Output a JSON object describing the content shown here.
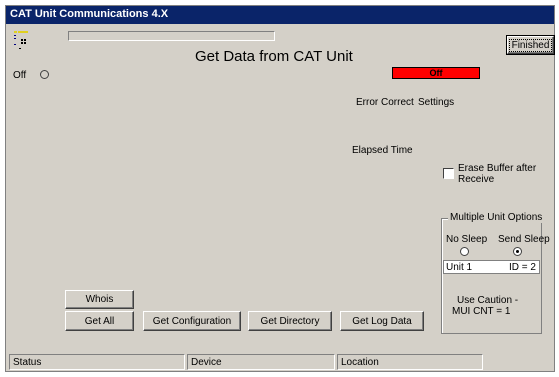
{
  "window": {
    "title": "CAT Unit Communications 4.X"
  },
  "header": {
    "heading": "Get Data from CAT Unit",
    "finished_label": "Finished"
  },
  "power": {
    "label": "Off"
  },
  "status_indicator": {
    "text": "Off",
    "color": "#ff0000"
  },
  "info": {
    "error_correct_label": "Error Correct",
    "settings_label": "Settings",
    "elapsed_time_label": "Elapsed Time"
  },
  "erase_buffer": {
    "label_line1": "Erase Buffer after",
    "label_line2": "Receive",
    "checked": false
  },
  "multi_unit": {
    "group_label": "Multiple Unit Options",
    "no_sleep_label": "No Sleep",
    "send_sleep_label": "Send Sleep",
    "selected": "Send Sleep",
    "unit_name": "Unit 1",
    "unit_id": "ID = 2",
    "caution_line1": "Use Caution  -",
    "caution_line2": "MUI CNT = 1"
  },
  "actions": {
    "whois": "Whois",
    "get_all": "Get All",
    "get_configuration": "Get Configuration",
    "get_directory": "Get Directory",
    "get_log_data": "Get Log Data"
  },
  "statusbar": {
    "status": "Status",
    "device": "Device",
    "location": "Location"
  },
  "icons": {
    "app_icon": "keypad-icon",
    "power_radio": "radio-icon"
  }
}
